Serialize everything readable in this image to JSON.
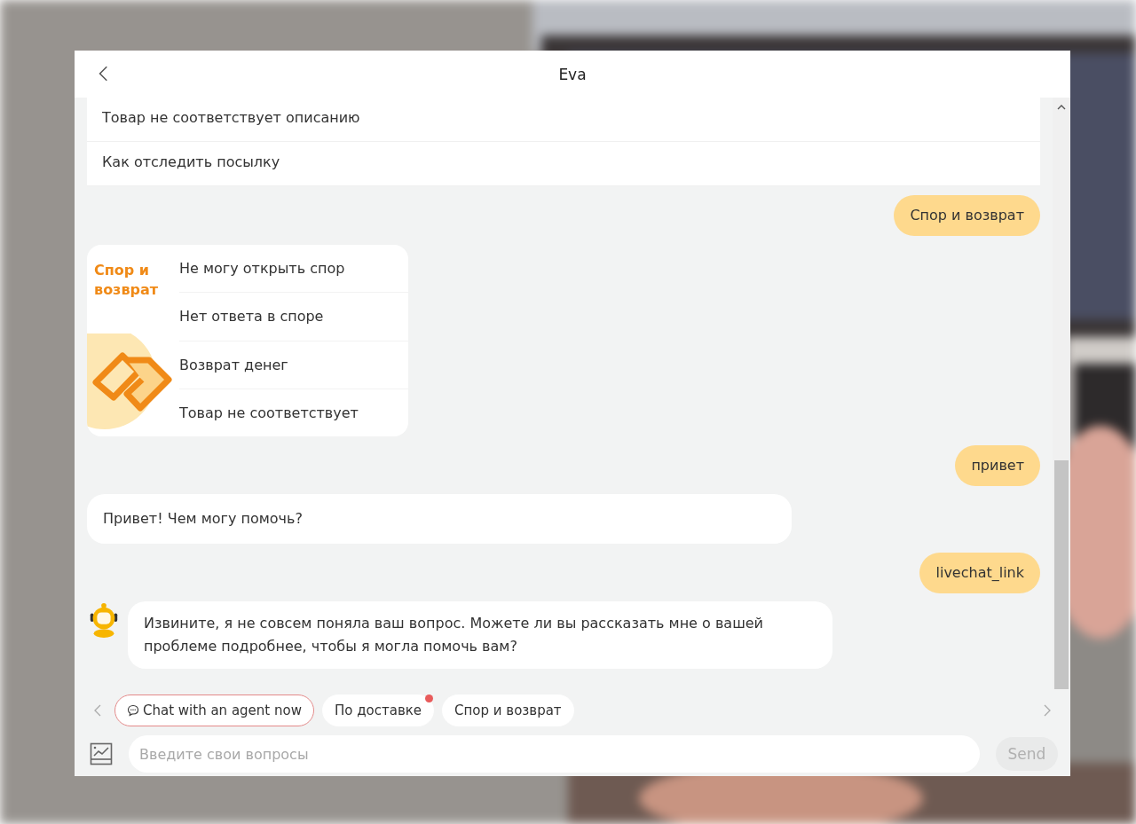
{
  "window": {
    "title": "Eva"
  },
  "messages": [
    {
      "kind": "option_list",
      "items": [
        "Товар не соответствует описанию",
        "Как отследить посылку"
      ]
    },
    {
      "kind": "user",
      "text": "Спор и возврат"
    },
    {
      "kind": "card",
      "title": "Спор и возврат",
      "items": [
        "Не могу открыть спор",
        "Нет ответа в споре",
        "Возврат денег",
        "Товар не соответствует"
      ]
    },
    {
      "kind": "user",
      "text": "привет"
    },
    {
      "kind": "bot",
      "text": "Привет! Чем могу помочь?"
    },
    {
      "kind": "user",
      "text": "livechat_link"
    },
    {
      "kind": "bot_avatar",
      "text": "Извините, я не совсем поняла ваш вопрос. Можете ли вы рассказать мне о вашей проблеме подробнее, чтобы я могла помочь вам?"
    }
  ],
  "quick_replies": [
    {
      "kind": "agent",
      "label": "Chat with an agent now",
      "badge": false
    },
    {
      "kind": "topic",
      "label": "По доставке",
      "badge": true
    },
    {
      "kind": "topic",
      "label": "Спор и возврат",
      "badge": false
    }
  ],
  "input": {
    "placeholder": "Введите свои вопросы"
  },
  "send_button": {
    "label": "Send",
    "disabled": true
  }
}
